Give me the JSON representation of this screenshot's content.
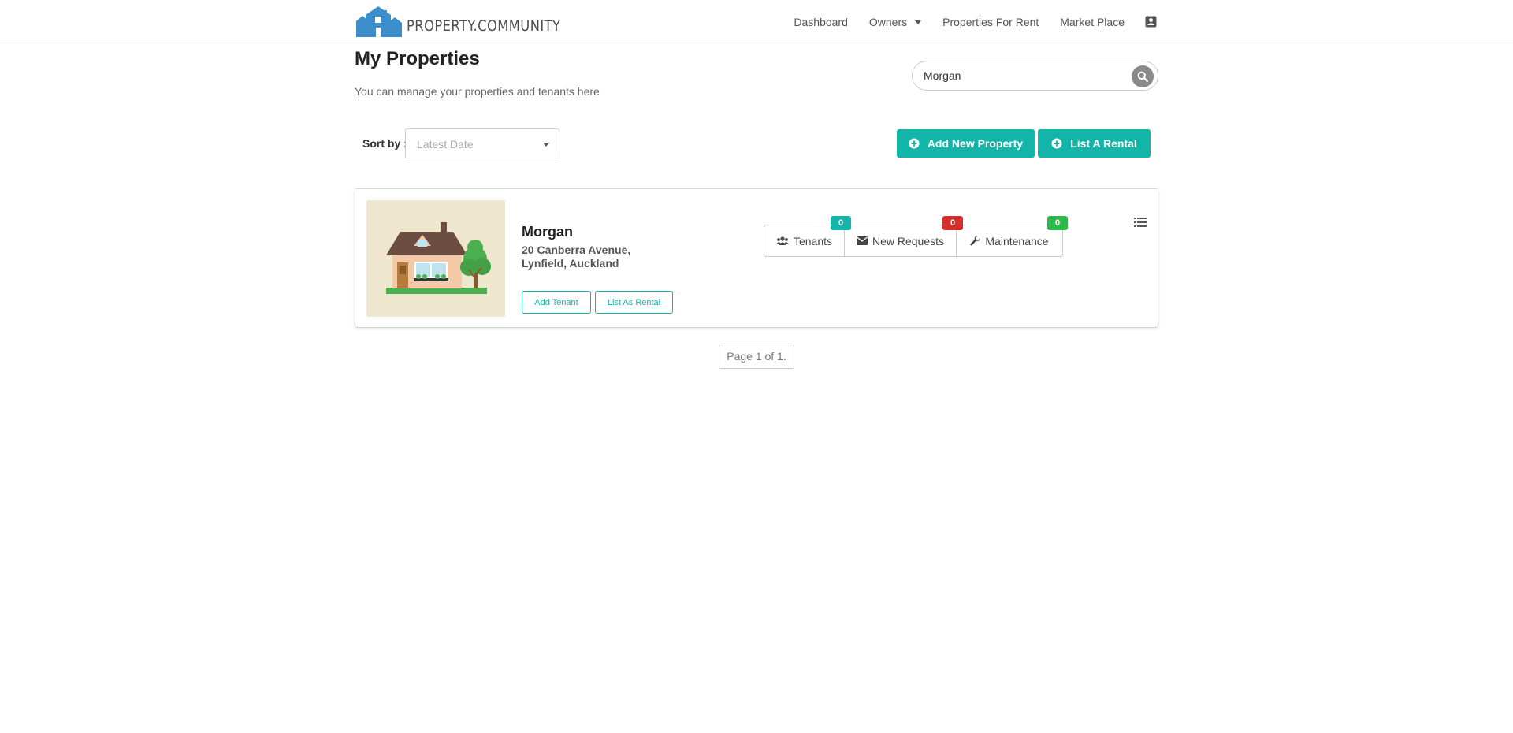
{
  "brand": {
    "name": "PROPERTY.COMMUNITY",
    "logo_icon": "house-logo-icon",
    "color": "#3d8fcb"
  },
  "nav": {
    "items": [
      {
        "label": "Dashboard"
      },
      {
        "label": "Owners",
        "has_dropdown": true
      },
      {
        "label": "Properties For Rent"
      },
      {
        "label": "Market Place"
      }
    ],
    "user_icon": "user-card-icon"
  },
  "page": {
    "title": "My Properties",
    "subtitle": "You can manage your properties and tenants here"
  },
  "search": {
    "value": "Morgan",
    "icon": "search-icon"
  },
  "toolbar": {
    "sort_label": "Sort by :",
    "sort_placeholder": "Latest Date",
    "add_property_label": "Add New Property",
    "list_rental_label": "List A Rental",
    "accent": "#12b5a8"
  },
  "properties": [
    {
      "name": "Morgan",
      "address_line1": "20 Canberra Avenue,",
      "address_line2": "Lynfield, Auckland",
      "add_tenant_label": "Add Tenant",
      "list_as_rental_label": "List As Rental",
      "stats": {
        "tenants": {
          "label": "Tenants",
          "count": "0",
          "color": "#12b5a8",
          "icon": "users-icon"
        },
        "requests": {
          "label": "New Requests",
          "count": "0",
          "color": "#d32f2f",
          "icon": "envelope-icon"
        },
        "maintenance": {
          "label": "Maintenance",
          "count": "0",
          "color": "#2eb84b",
          "icon": "wrench-icon"
        }
      },
      "menu_icon": "list-menu-icon"
    }
  ],
  "pagination": {
    "text": "Page 1 of 1."
  }
}
